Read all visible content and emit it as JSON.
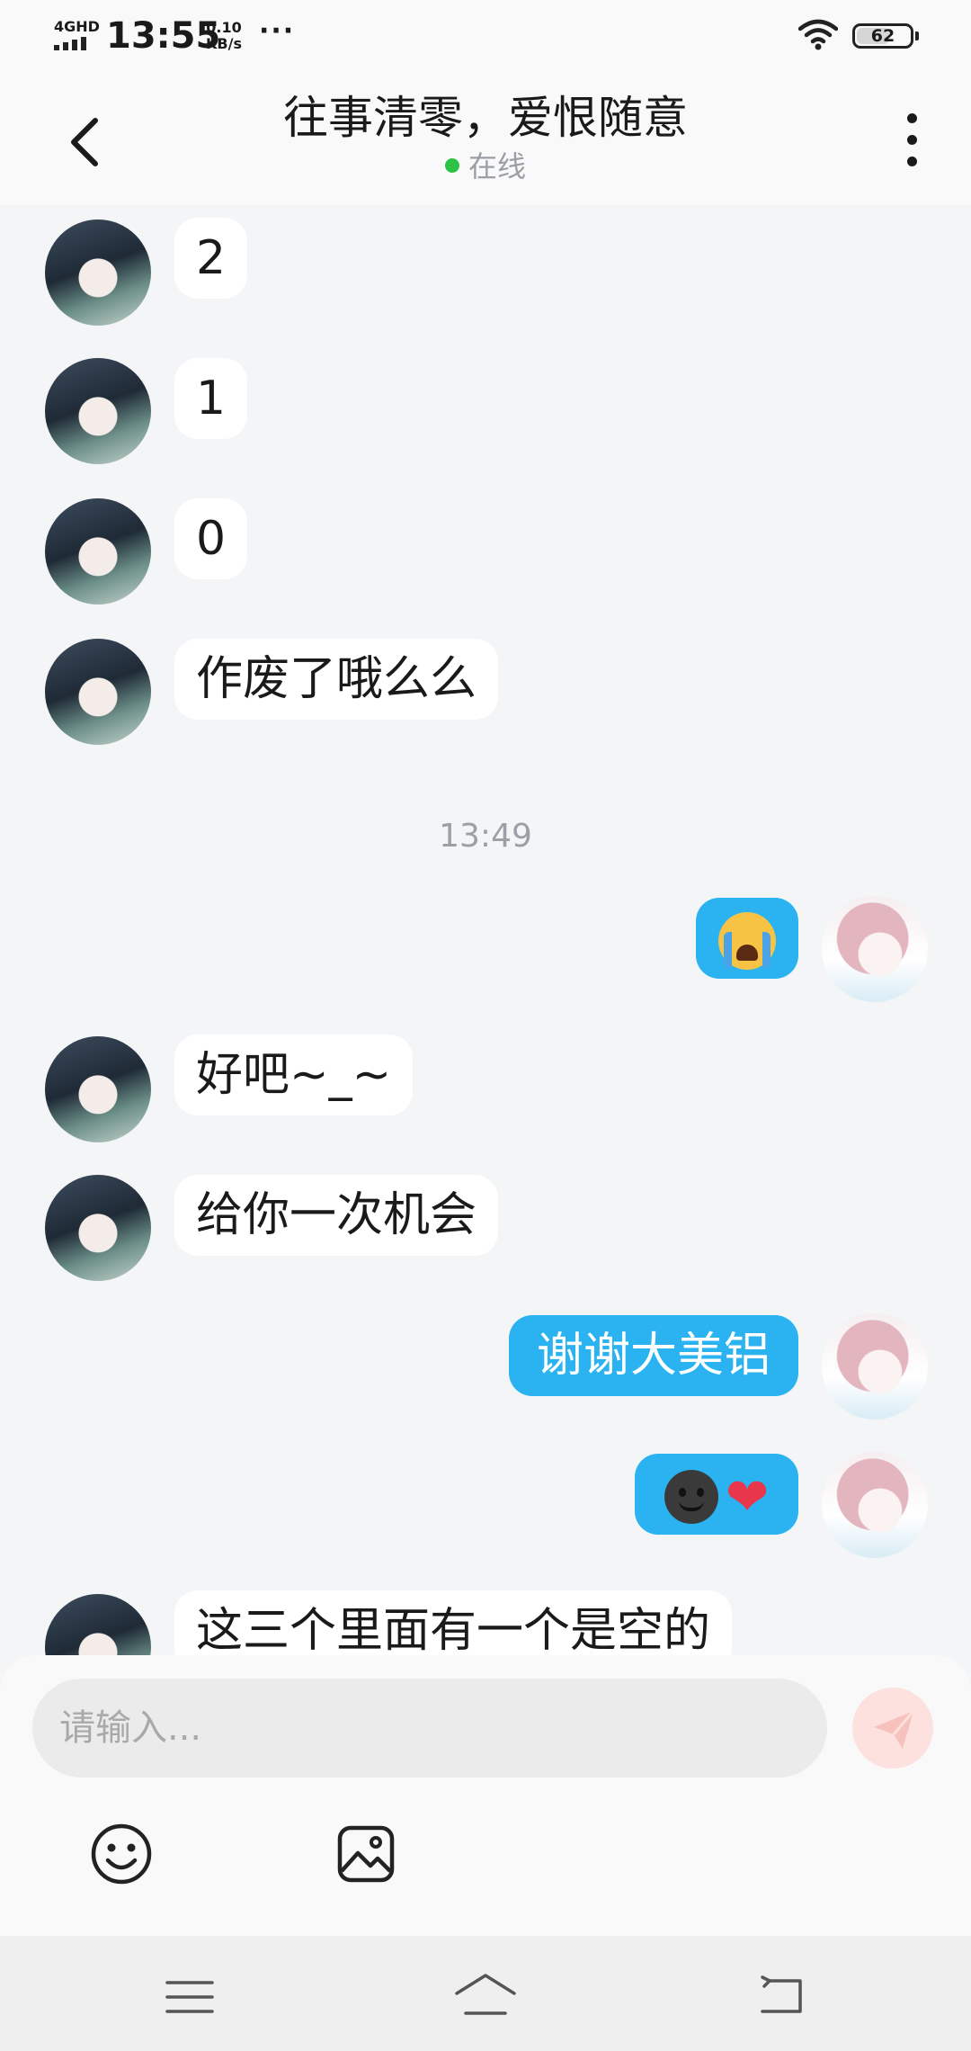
{
  "status_bar": {
    "network": "4GHD",
    "time": "13:55",
    "speed_value": "0.10",
    "speed_unit": "KB/s",
    "more": "···",
    "battery": "62",
    "battery_level": 0.62
  },
  "header": {
    "title": "往事清零，爱恨随意",
    "status": "在线"
  },
  "messages": [
    {
      "side": "in",
      "text": "2"
    },
    {
      "side": "in",
      "text": "1"
    },
    {
      "side": "in",
      "text": "0"
    },
    {
      "side": "in",
      "text": "作废了哦么么"
    },
    {
      "timestamp": "13:49"
    },
    {
      "side": "out",
      "emoji": "loudly-crying-face-emoji"
    },
    {
      "side": "in",
      "text": "好吧~_~"
    },
    {
      "side": "in",
      "text": "给你一次机会"
    },
    {
      "side": "out",
      "text": "谢谢大美铝"
    },
    {
      "side": "out",
      "emoji": "dark-smiley-emoji + heart-emoji"
    },
    {
      "side": "in",
      "text": "这三个里面有一个是空的"
    }
  ],
  "composer": {
    "placeholder": "请输入...",
    "send_icon": "paper-plane-icon",
    "emoji_icon": "smiley-icon",
    "image_icon": "image-icon"
  },
  "colors": {
    "accent": "#2bb3f1",
    "online": "#2bc245",
    "background": "#f4f5f7",
    "send_disabled": "#fde1df"
  },
  "navbar": {
    "icons": [
      "menu-icon",
      "home-icon",
      "back-icon"
    ]
  }
}
